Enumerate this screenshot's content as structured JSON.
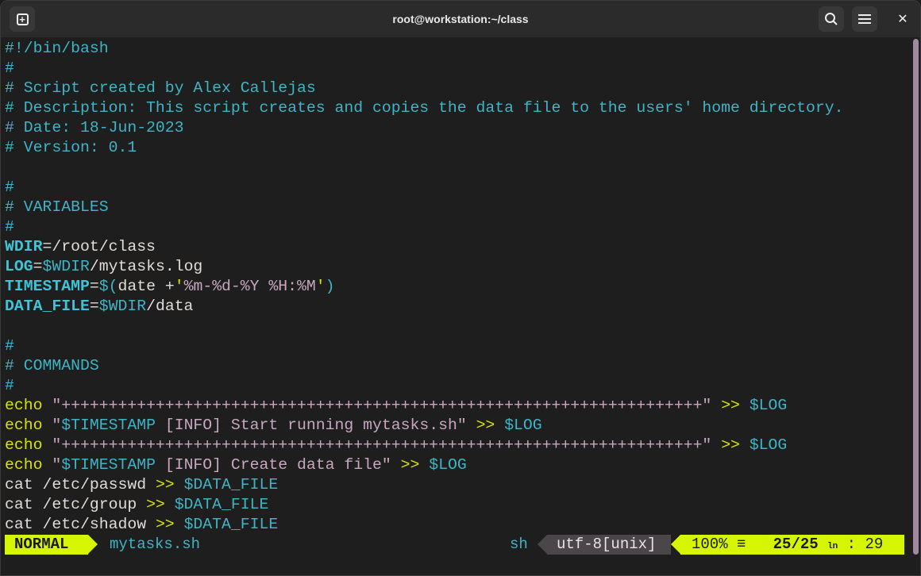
{
  "window": {
    "title": "root@workstation:~/class"
  },
  "colors": {
    "accent": "#d6f500",
    "comment": "#3fb4c6",
    "keyword": "#d7e400",
    "string": "#c8a7bf"
  },
  "lines": [
    [
      {
        "t": "#!/bin/bash",
        "c": "c"
      }
    ],
    [
      {
        "t": "#",
        "c": "c"
      }
    ],
    [
      {
        "t": "# Script created by Alex Callejas",
        "c": "c"
      }
    ],
    [
      {
        "t": "# Description: This script creates and copies the data file to the users' home directory.",
        "c": "c"
      }
    ],
    [
      {
        "t": "# Date: 18-Jun-2023",
        "c": "c"
      }
    ],
    [
      {
        "t": "# Version: 0.1",
        "c": "c"
      }
    ],
    [],
    [
      {
        "t": "#",
        "c": "c"
      }
    ],
    [
      {
        "t": "# VARIABLES",
        "c": "c"
      }
    ],
    [
      {
        "t": "#",
        "c": "c"
      }
    ],
    [
      {
        "t": "WDIR",
        "c": "v"
      },
      {
        "t": "=/root/class",
        "c": "d"
      }
    ],
    [
      {
        "t": "LOG",
        "c": "v"
      },
      {
        "t": "=",
        "c": "d"
      },
      {
        "t": "$WDIR",
        "c": "ds"
      },
      {
        "t": "/mytasks.log",
        "c": "d"
      }
    ],
    [
      {
        "t": "TIMESTAMP",
        "c": "v"
      },
      {
        "t": "=",
        "c": "d"
      },
      {
        "t": "$(",
        "c": "ds"
      },
      {
        "t": "date +",
        "c": "d"
      },
      {
        "t": "'",
        "c": "y"
      },
      {
        "t": "%m-%d-%Y %H:%M",
        "c": "s"
      },
      {
        "t": "'",
        "c": "y"
      },
      {
        "t": ")",
        "c": "ds"
      }
    ],
    [
      {
        "t": "DATA_FILE",
        "c": "v"
      },
      {
        "t": "=",
        "c": "d"
      },
      {
        "t": "$WDIR",
        "c": "ds"
      },
      {
        "t": "/data",
        "c": "d"
      }
    ],
    [],
    [
      {
        "t": "#",
        "c": "c"
      }
    ],
    [
      {
        "t": "# COMMANDS",
        "c": "c"
      }
    ],
    [
      {
        "t": "#",
        "c": "c"
      }
    ],
    [
      {
        "t": "echo",
        "c": "y"
      },
      {
        "t": " ",
        "c": "d"
      },
      {
        "t": "\"++++++++++++++++++++++++++++++++++++++++++++++++++++++++++++++++++++\"",
        "c": "s"
      },
      {
        "t": " ",
        "c": "d"
      },
      {
        "t": ">>",
        "c": "y"
      },
      {
        "t": " ",
        "c": "d"
      },
      {
        "t": "$LOG",
        "c": "ds"
      }
    ],
    [
      {
        "t": "echo",
        "c": "y"
      },
      {
        "t": " ",
        "c": "d"
      },
      {
        "t": "\"",
        "c": "s"
      },
      {
        "t": "$TIMESTAMP",
        "c": "ds"
      },
      {
        "t": " [INFO] Start running mytasks.sh\"",
        "c": "s"
      },
      {
        "t": " ",
        "c": "d"
      },
      {
        "t": ">>",
        "c": "y"
      },
      {
        "t": " ",
        "c": "d"
      },
      {
        "t": "$LOG",
        "c": "ds"
      }
    ],
    [
      {
        "t": "echo",
        "c": "y"
      },
      {
        "t": " ",
        "c": "d"
      },
      {
        "t": "\"++++++++++++++++++++++++++++++++++++++++++++++++++++++++++++++++++++\"",
        "c": "s"
      },
      {
        "t": " ",
        "c": "d"
      },
      {
        "t": ">>",
        "c": "y"
      },
      {
        "t": " ",
        "c": "d"
      },
      {
        "t": "$LOG",
        "c": "ds"
      }
    ],
    [
      {
        "t": "echo",
        "c": "y"
      },
      {
        "t": " ",
        "c": "d"
      },
      {
        "t": "\"",
        "c": "s"
      },
      {
        "t": "$TIMESTAMP",
        "c": "ds"
      },
      {
        "t": " [INFO] Create data file\"",
        "c": "s"
      },
      {
        "t": " ",
        "c": "d"
      },
      {
        "t": ">>",
        "c": "y"
      },
      {
        "t": " ",
        "c": "d"
      },
      {
        "t": "$LOG",
        "c": "ds"
      }
    ],
    [
      {
        "t": "cat /etc/passwd ",
        "c": "d"
      },
      {
        "t": ">>",
        "c": "y"
      },
      {
        "t": " ",
        "c": "d"
      },
      {
        "t": "$DATA_FILE",
        "c": "ds"
      }
    ],
    [
      {
        "t": "cat /etc/group ",
        "c": "d"
      },
      {
        "t": ">>",
        "c": "y"
      },
      {
        "t": " ",
        "c": "d"
      },
      {
        "t": "$DATA_FILE",
        "c": "ds"
      }
    ],
    [
      {
        "t": "cat /etc/shadow ",
        "c": "d"
      },
      {
        "t": ">>",
        "c": "y"
      },
      {
        "t": " ",
        "c": "d"
      },
      {
        "t": "$DATA_FILE",
        "c": "ds"
      }
    ]
  ],
  "statusline": {
    "mode": "NORMAL",
    "filename": "mytasks.sh",
    "filetype": "sh",
    "encoding": "utf-8[unix]",
    "percent": "100%",
    "line": "25/25",
    "column": "29",
    "line_symbol": "ln"
  }
}
